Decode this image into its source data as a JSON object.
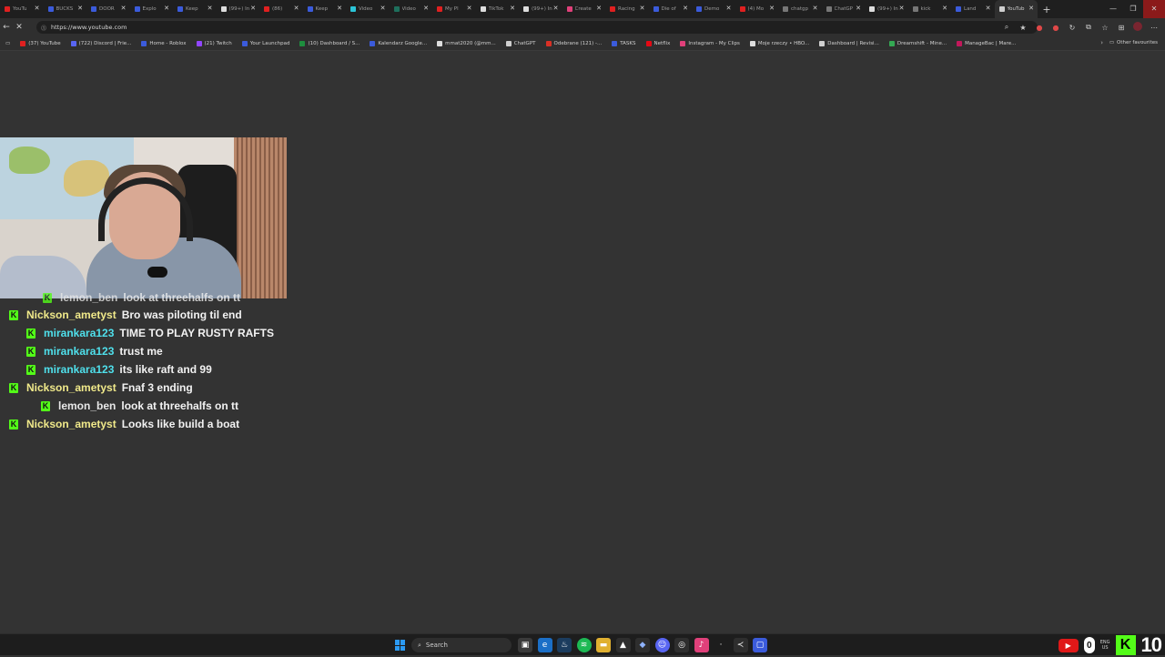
{
  "browser": {
    "tabs": [
      {
        "label": "YouTu",
        "color": "#e02020"
      },
      {
        "label": "BUCKS",
        "color": "#3b5bdb"
      },
      {
        "label": "DOOR",
        "color": "#3b5bdb"
      },
      {
        "label": "Explo",
        "color": "#3b5bdb"
      },
      {
        "label": "Keep",
        "color": "#3b5bdb"
      },
      {
        "label": "(99+) In",
        "color": "#dddddd"
      },
      {
        "label": "(86)",
        "color": "#e02020"
      },
      {
        "label": "Keep",
        "color": "#3b5bdb"
      },
      {
        "label": "Video",
        "color": "#2bc4d8"
      },
      {
        "label": "Video",
        "color": "#1e6f5c"
      },
      {
        "label": "My Pl",
        "color": "#e02020"
      },
      {
        "label": "TikTok",
        "color": "#dddddd"
      },
      {
        "label": "(99+) In",
        "color": "#dddddd"
      },
      {
        "label": "Create",
        "color": "#e0407a"
      },
      {
        "label": "Racing",
        "color": "#e02020"
      },
      {
        "label": "Die of",
        "color": "#3b5bdb"
      },
      {
        "label": "Demo",
        "color": "#3b5bdb"
      },
      {
        "label": "(4) Mo",
        "color": "#e02020"
      },
      {
        "label": "chatgp",
        "color": "#777777"
      },
      {
        "label": "ChatGP",
        "color": "#777777"
      },
      {
        "label": "(99+) In",
        "color": "#dddddd"
      },
      {
        "label": "kick",
        "color": "#777777"
      },
      {
        "label": "Land",
        "color": "#3b5bdb"
      },
      {
        "label": "YouTub",
        "color": "#cfcfcf",
        "active": true
      }
    ],
    "new_tab_glyph": "+",
    "window_controls": {
      "minimize": "—",
      "maximize": "❐",
      "close": "✕"
    },
    "url": "https://www.youtube.com",
    "bookmarks": [
      {
        "label": "(37) YouTube",
        "color": "#e02020"
      },
      {
        "label": "(722) Discord | Frie...",
        "color": "#5865f2"
      },
      {
        "label": "Home - Roblox",
        "color": "#3b5bdb"
      },
      {
        "label": "(21) Twitch",
        "color": "#9146ff"
      },
      {
        "label": "Your Launchpad",
        "color": "#3b5bdb"
      },
      {
        "label": "(10) Dashboard / S...",
        "color": "#1e8e3e"
      },
      {
        "label": "Kalendarz Google...",
        "color": "#3b5bdb"
      },
      {
        "label": "mmat2020 (@mm...",
        "color": "#dddddd"
      },
      {
        "label": "ChatGPT",
        "color": "#cfcfcf"
      },
      {
        "label": "Odebrane (121) -...",
        "color": "#d93025"
      },
      {
        "label": "TASKS",
        "color": "#3b5bdb"
      },
      {
        "label": "Netflix",
        "color": "#e50914"
      },
      {
        "label": "Instagram - My Clips",
        "color": "#e0407a"
      },
      {
        "label": "Moje rzeczy • HBO...",
        "color": "#dddddd"
      },
      {
        "label": "Dashboard | Revisi...",
        "color": "#cfcfcf"
      },
      {
        "label": "Dreamshift - Mine...",
        "color": "#34a853"
      },
      {
        "label": "ManageBac | Mare...",
        "color": "#c2185b"
      }
    ],
    "other_favourites": "Other favourites"
  },
  "chat": {
    "badge_letter": "K",
    "cut_row": {
      "username": "lemon_ben",
      "message": "look at threehalfs on tt"
    },
    "rows": [
      {
        "username": "Nickson_ametyst",
        "message": "Bro was piloting til end",
        "color": "#f0e98a"
      },
      {
        "username": "mirankara123",
        "message": "TIME TO PLAY RUSTY RAFTS",
        "color": "#4fe0ec"
      },
      {
        "username": "mirankara123",
        "message": "trust me",
        "color": "#4fe0ec"
      },
      {
        "username": "mirankara123",
        "message": "its like raft and 99",
        "color": "#4fe0ec"
      },
      {
        "username": "Nickson_ametyst",
        "message": "Fnaf 3 ending",
        "color": "#f0e98a"
      },
      {
        "username": "lemon_ben",
        "message": "look at threehalfs on tt",
        "color": "#e8e8e8"
      },
      {
        "username": "Nickson_ametyst",
        "message": "Looks like build a boat",
        "color": "#f0e98a"
      }
    ]
  },
  "taskbar": {
    "search_placeholder": "Search",
    "lang_top": "ENG",
    "lang_bottom": "US",
    "overlay_zero": "0",
    "overlay_badge": "K",
    "overlay_count": "10"
  },
  "colors": {
    "kick_green": "#53fc18",
    "background": "#333333"
  }
}
